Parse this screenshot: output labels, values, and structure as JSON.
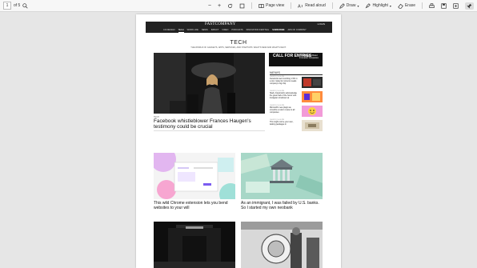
{
  "toolbar": {
    "page_current": "1",
    "page_total": "of 5",
    "zoom_out": "−",
    "zoom_in": "+",
    "page_view": "Page view",
    "read_aloud": "Read aloud",
    "draw": "Draw",
    "highlight": "Highlight",
    "erase": "Erase"
  },
  "site": {
    "logo": "FASTCOMPANY",
    "header_right": "LOGIN",
    "nav": [
      "CO.DESIGN",
      "TECH",
      "WORK LIFE",
      "NEWS",
      "IMPACT",
      "VIDEO",
      "PODCASTS",
      "INNOVATION FESTIVAL",
      "SUBSCRIBE",
      "ADS OF COMPANY"
    ],
    "section_title": "TECH",
    "section_subtitle": "THE WORLD OF GADGETS, APPS, SERVICES, AND STARTUPS: WHAT'S NEW AND WHAT'S NEXT."
  },
  "hero": {
    "kicker": "TECH",
    "title": "Facebook whistleblower Frances Haugen's testimony could be crucial"
  },
  "ad": {
    "title": "CALL FOR ENTRIES",
    "subtitle": "Fast Company Brand Innovation Companies"
  },
  "news": {
    "label": "NEWS",
    "items": [
      {
        "meta": "10/05/21 | 10:00 PM",
        "text": "Facebook went tumbling 1.5% in a row: make far content reveals company's big chip"
      },
      {
        "meta": "10/05/21 | 10:00 PM",
        "text": "Slack, Facebook's acknowledge the great 'lack of the hours' and Instagram shutdown at"
      },
      {
        "meta": "10/05/21 | 10:00 PM",
        "text": "Microsoft's new plugin as smooths a return review to all companies"
      },
      {
        "meta": "10/05/21 | 10:00 PM",
        "text": "This might not be your own, lacking packages in"
      }
    ]
  },
  "cards": [
    {
      "title": "This wild Chrome extension lets you bend websites to your will"
    },
    {
      "title": "As an immigrant, I was failed by U.S. banks. So I started my own neobank"
    },
    {
      "title": ""
    },
    {
      "title": ""
    }
  ],
  "colors": {
    "header_bg": "#222222",
    "page_bg": "#ffffff",
    "viewer_bg": "#e6e6e6",
    "ad_accent": "#2bb673"
  }
}
